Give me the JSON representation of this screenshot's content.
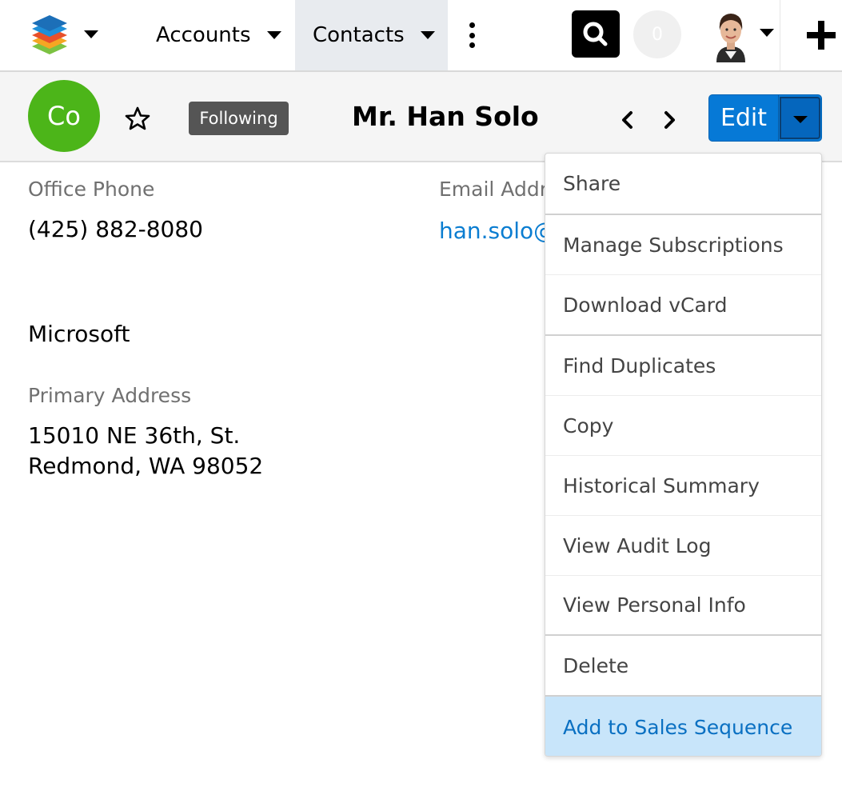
{
  "nav": {
    "tabs": [
      {
        "label": "Accounts"
      },
      {
        "label": "Contacts",
        "active": true
      }
    ],
    "notification_count": "0",
    "icons": {
      "logo": "sugar-cube-logo",
      "more": "vertical-ellipsis-icon",
      "search": "search-icon",
      "create": "plus-icon"
    }
  },
  "record": {
    "module_abbrev": "Co",
    "module_color": "#4cb519",
    "follow_label": "Following",
    "title": "Mr. Han Solo",
    "edit_label": "Edit",
    "accent_color": "#0679d6"
  },
  "fields": {
    "office_phone_label": "Office Phone",
    "office_phone": "(425) 882-8080",
    "email_label": "Email Address",
    "email": "han.solo@",
    "account_name": "Microsoft",
    "primary_address_label": "Primary Address",
    "address_line1": "15010 NE 36th, St.",
    "address_line2": "Redmond, WA 98052"
  },
  "actions_menu": {
    "items": [
      {
        "label": "Share"
      },
      {
        "label": "Manage Subscriptions"
      },
      {
        "label": "Download vCard"
      },
      {
        "label": "Find Duplicates"
      },
      {
        "label": "Copy"
      },
      {
        "label": "Historical Summary"
      },
      {
        "label": "View Audit Log"
      },
      {
        "label": "View Personal Info"
      },
      {
        "label": "Delete"
      },
      {
        "label": "Add to Sales Sequence",
        "highlighted": true
      }
    ],
    "highlight_color": "#c8e5fa"
  }
}
